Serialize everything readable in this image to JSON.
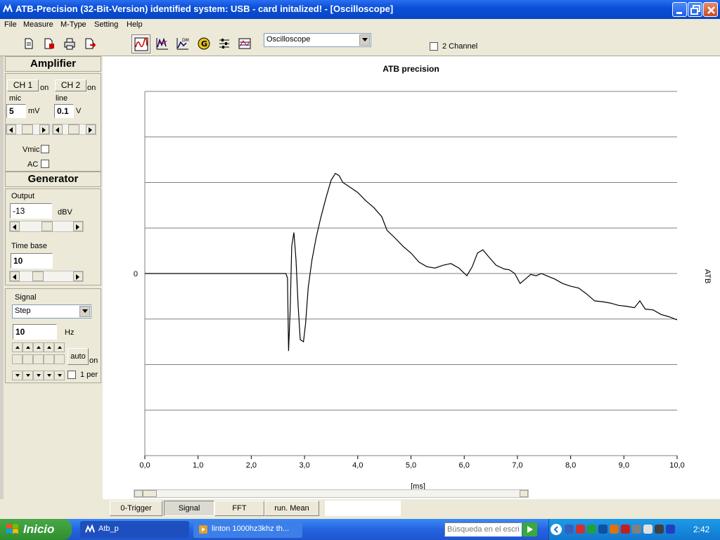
{
  "window": {
    "title": "ATB-Precision  (32-Bit-Version)  identified system: USB - card  initalized! - [Oscilloscope]"
  },
  "menu": [
    "File",
    "Measure",
    "M-Type",
    "Setting",
    "Help"
  ],
  "toolbar": {
    "mode_select": "Oscilloscope",
    "two_channel_label": "2 Channel"
  },
  "amplifier": {
    "header": "Amplifier",
    "ch1": "CH 1",
    "ch1_state": "on",
    "ch2": "CH 2",
    "ch2_state": "on",
    "mic_label": "mic",
    "mic_value": "5",
    "mic_unit": "mV",
    "line_label": "line",
    "line_value": "0.1",
    "line_unit": "V",
    "vmic_label": "Vmic",
    "ac_label": "AC"
  },
  "generator": {
    "header": "Generator",
    "output_label": "Output",
    "output_value": "-13",
    "output_unit": "dBV",
    "timebase_label": "Time base",
    "timebase_value": "10"
  },
  "signal": {
    "label": "Signal",
    "type": "Step",
    "freq_value": "10",
    "freq_unit": "Hz",
    "auto_label": "auto",
    "auto_state": "on",
    "one_per_label": "1 per"
  },
  "tabs": [
    "0-Trigger",
    "Signal",
    "FFT",
    "run. Mean"
  ],
  "active_tab": "Signal",
  "taskbar": {
    "start_label": "Inicio",
    "task1": "Atb_p",
    "task2": "linton 1000hz3khz th...",
    "search_placeholder": "Búsqueda en el escri",
    "clock": "2:42"
  },
  "colors": {
    "titlebar": "#0a4fd8",
    "chart_line": "#000000",
    "grid": "#808080"
  },
  "chart_data": {
    "type": "line",
    "title": "ATB precision",
    "xlabel": "[ms]",
    "ylabel": "ATB",
    "xlim": [
      0,
      10
    ],
    "ylim": [
      -4,
      4
    ],
    "x_ticks": [
      "0,0",
      "1,0",
      "2,0",
      "3,0",
      "4,0",
      "5,0",
      "6,0",
      "7,0",
      "8,0",
      "9,0",
      "10,0"
    ],
    "y_tick_label": "0",
    "grid": "horizontal",
    "points": [
      [
        0.0,
        0.0
      ],
      [
        2.65,
        0.0
      ],
      [
        2.68,
        -0.1
      ],
      [
        2.7,
        -1.7
      ],
      [
        2.73,
        -0.8
      ],
      [
        2.76,
        0.6
      ],
      [
        2.8,
        0.9
      ],
      [
        2.84,
        0.3
      ],
      [
        2.88,
        -0.7
      ],
      [
        2.92,
        -1.45
      ],
      [
        2.98,
        -1.5
      ],
      [
        3.02,
        -1.1
      ],
      [
        3.07,
        -0.3
      ],
      [
        3.14,
        0.3
      ],
      [
        3.22,
        0.8
      ],
      [
        3.3,
        1.2
      ],
      [
        3.4,
        1.65
      ],
      [
        3.5,
        2.05
      ],
      [
        3.58,
        2.2
      ],
      [
        3.65,
        2.15
      ],
      [
        3.72,
        2.0
      ],
      [
        3.85,
        1.9
      ],
      [
        4.0,
        1.78
      ],
      [
        4.15,
        1.6
      ],
      [
        4.3,
        1.45
      ],
      [
        4.45,
        1.25
      ],
      [
        4.55,
        0.95
      ],
      [
        4.7,
        0.78
      ],
      [
        4.85,
        0.6
      ],
      [
        5.0,
        0.45
      ],
      [
        5.15,
        0.25
      ],
      [
        5.3,
        0.15
      ],
      [
        5.45,
        0.12
      ],
      [
        5.6,
        0.18
      ],
      [
        5.75,
        0.22
      ],
      [
        5.9,
        0.12
      ],
      [
        6.05,
        -0.05
      ],
      [
        6.15,
        0.15
      ],
      [
        6.25,
        0.45
      ],
      [
        6.35,
        0.52
      ],
      [
        6.45,
        0.38
      ],
      [
        6.6,
        0.18
      ],
      [
        6.75,
        0.1
      ],
      [
        6.85,
        0.08
      ],
      [
        6.95,
        0.0
      ],
      [
        7.05,
        -0.22
      ],
      [
        7.15,
        -0.12
      ],
      [
        7.25,
        -0.02
      ],
      [
        7.35,
        -0.05
      ],
      [
        7.45,
        0.0
      ],
      [
        7.55,
        -0.05
      ],
      [
        7.7,
        -0.12
      ],
      [
        7.85,
        -0.22
      ],
      [
        8.0,
        -0.28
      ],
      [
        8.15,
        -0.32
      ],
      [
        8.3,
        -0.45
      ],
      [
        8.45,
        -0.6
      ],
      [
        8.6,
        -0.62
      ],
      [
        8.75,
        -0.65
      ],
      [
        8.9,
        -0.7
      ],
      [
        9.05,
        -0.72
      ],
      [
        9.2,
        -0.75
      ],
      [
        9.3,
        -0.6
      ],
      [
        9.4,
        -0.78
      ],
      [
        9.55,
        -0.8
      ],
      [
        9.7,
        -0.9
      ],
      [
        9.85,
        -0.95
      ],
      [
        10.0,
        -1.02
      ]
    ]
  }
}
